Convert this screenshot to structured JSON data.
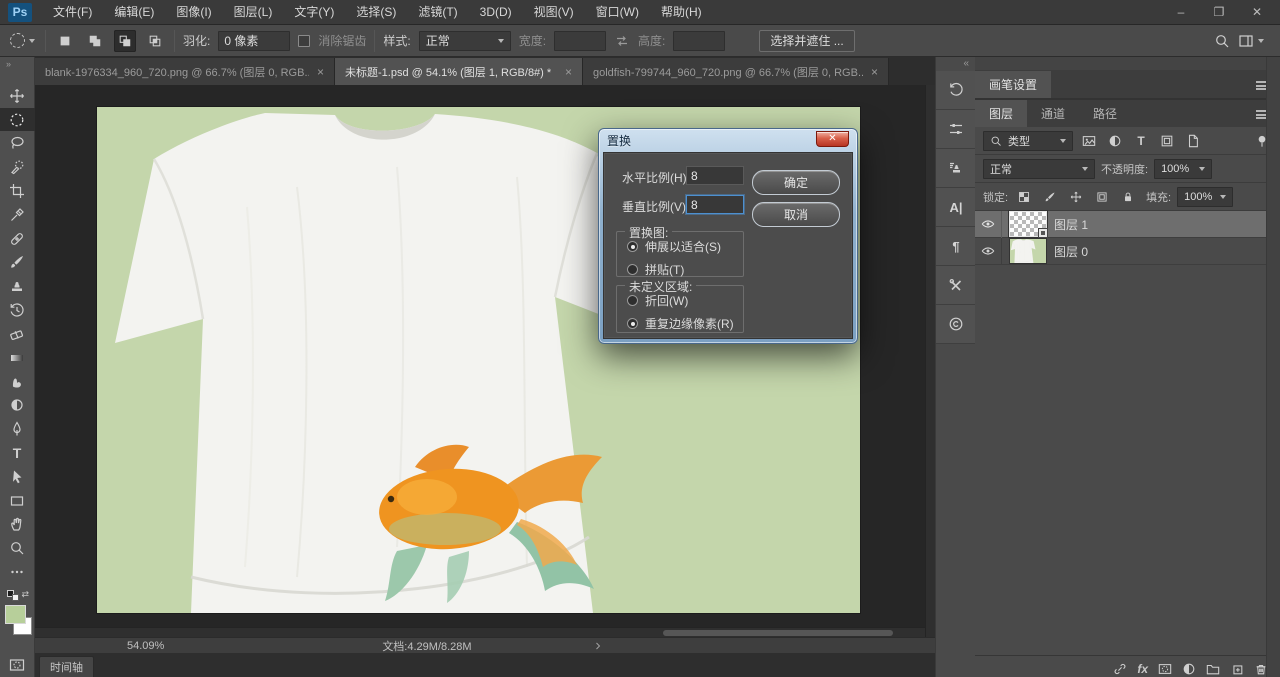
{
  "app": {
    "logo_text": "Ps",
    "window_controls": {
      "minimize": "–",
      "restore": "❐",
      "close": "✕"
    }
  },
  "menubar": {
    "items": [
      "文件(F)",
      "编辑(E)",
      "图像(I)",
      "图层(L)",
      "文字(Y)",
      "选择(S)",
      "滤镜(T)",
      "3D(D)",
      "视图(V)",
      "窗口(W)",
      "帮助(H)"
    ]
  },
  "options_bar": {
    "feather_label": "羽化:",
    "feather_value": "0 像素",
    "antialias_label": "消除锯齿",
    "style_label": "样式:",
    "style_value": "正常",
    "width_label": "宽度:",
    "width_value": "",
    "height_label": "高度:",
    "height_value": "",
    "select_and_mask_button": "选择并遮住 ..."
  },
  "document_tabs": [
    {
      "title": "blank-1976334_960_720.png @ 66.7% (图层 0, RGB...",
      "close_glyph": "×",
      "active": false
    },
    {
      "title": "未标题-1.psd @ 54.1% (图层 1, RGB/8#) *",
      "close_glyph": "×",
      "active": true
    },
    {
      "title": "goldfish-799744_960_720.png @ 66.7% (图层 0, RGB...",
      "close_glyph": "×",
      "active": false
    }
  ],
  "dialog": {
    "title": "置换",
    "close_glyph": "✕",
    "horizontal_scale": {
      "label": "水平比例(H)",
      "value": "8"
    },
    "vertical_scale": {
      "label": "垂直比例(V)",
      "value": "8"
    },
    "ok_button": "确定",
    "cancel_button": "取消",
    "displacement_map_group": {
      "legend": "置换图:",
      "options": [
        {
          "label": "伸展以适合(S)",
          "selected": true
        },
        {
          "label": "拼贴(T)",
          "selected": false
        }
      ]
    },
    "undefined_areas_group": {
      "legend": "未定义区域:",
      "options": [
        {
          "label": "折回(W)",
          "selected": false
        },
        {
          "label": "重复边缘像素(R)",
          "selected": true
        }
      ]
    }
  },
  "right_panels": {
    "brush_settings_tab": "画笔设置",
    "layers_panel": {
      "tabs": [
        "图层",
        "通道",
        "路径"
      ],
      "filter_type_label": "类型",
      "blend_mode_value": "正常",
      "opacity_label": "不透明度:",
      "opacity_value": "100%",
      "lock_label": "锁定:",
      "fill_label": "填充:",
      "fill_value": "100%",
      "fx_glyph": "fx",
      "layers": [
        {
          "name": "图层 1",
          "selected": true
        },
        {
          "name": "图层 0",
          "selected": false
        }
      ]
    }
  },
  "status_bar": {
    "zoom_level": "54.09%",
    "document_info": "文档:4.29M/8.28M"
  },
  "timeline": {
    "tab_label": "时间轴"
  },
  "colors": {
    "canvas_background": "#c4d6ab",
    "foreground_swatch": "#b7cf9a",
    "background_swatch": "#ffffff",
    "focus_border": "#4d90d0",
    "dialog_titlebar": "#a9c4de",
    "selected_layer_row": "#6e6e6e"
  }
}
